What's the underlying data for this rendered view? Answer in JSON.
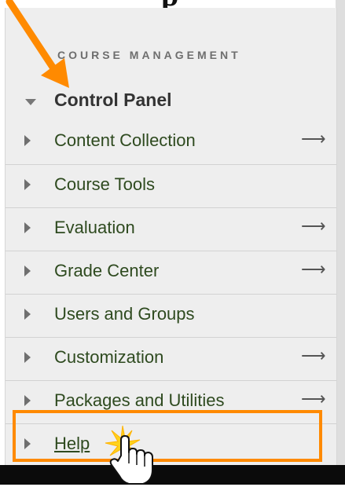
{
  "header_text": "p",
  "section_title": "COURSE MANAGEMENT",
  "control_panel": {
    "label": "Control Panel",
    "expanded": true
  },
  "menu_items": [
    {
      "label": "Content Collection",
      "has_arrow": true,
      "arrow": "⟶"
    },
    {
      "label": "Course Tools",
      "has_arrow": false,
      "arrow": ""
    },
    {
      "label": "Evaluation",
      "has_arrow": true,
      "arrow": "⟶"
    },
    {
      "label": "Grade Center",
      "has_arrow": true,
      "arrow": "⟶"
    },
    {
      "label": "Users and Groups",
      "has_arrow": false,
      "arrow": ""
    },
    {
      "label": "Customization",
      "has_arrow": true,
      "arrow": "⟶"
    },
    {
      "label": "Packages and Utilities",
      "has_arrow": true,
      "arrow": "⟶"
    },
    {
      "label": "Help",
      "has_arrow": false,
      "arrow": "",
      "highlighted": true
    }
  ],
  "colors": {
    "accent_orange": "#ff8a00",
    "link_green": "#2e4a1f",
    "panel_bg": "#eeeeee"
  },
  "icons": [
    "collapse-triangle-icon",
    "expand-triangle-icon",
    "right-arrow-icon",
    "orange-pointer-arrow-icon",
    "hand-cursor-icon",
    "click-burst-icon"
  ]
}
